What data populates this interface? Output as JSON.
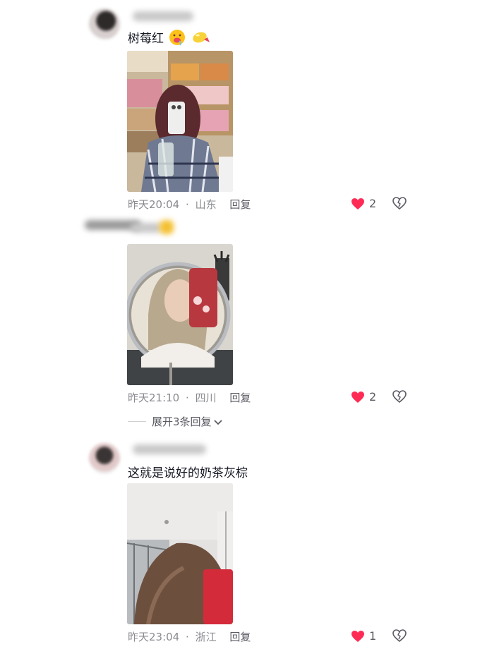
{
  "comments": [
    {
      "text": "树莓红",
      "emojis": [
        "drooling-face-emoji",
        "lemon-emoji"
      ],
      "photo": "mirror-selfie-in-store-photo",
      "time": "昨天20:04",
      "location": "山东",
      "reply": "回复",
      "likes": "2"
    },
    {
      "text": "",
      "photo": "round-mirror-selfie-photo",
      "time": "昨天21:10",
      "location": "四川",
      "reply": "回复",
      "likes": "2",
      "expand": "展开3条回复"
    },
    {
      "text": "这就是说好的奶茶灰棕",
      "photo": "hair-selfie-with-red-phone-photo",
      "time": "昨天23:04",
      "location": "浙江",
      "reply": "回复",
      "likes": "1"
    }
  ],
  "separator": "·",
  "colors": {
    "like": "#fe2c55",
    "meta": "#8a8b91"
  }
}
